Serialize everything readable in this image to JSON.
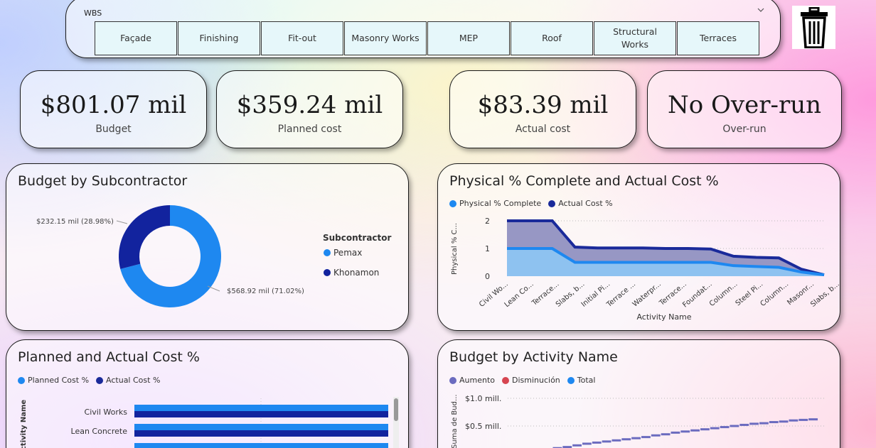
{
  "wbs": {
    "label": "WBS",
    "items": [
      "Façade",
      "Finishing",
      "Fit-out",
      "Masonry Works",
      "MEP",
      "Roof",
      "Structural Works",
      "Terraces"
    ]
  },
  "kpis": [
    {
      "value": "$801.07 mil",
      "label": "Budget"
    },
    {
      "value": "$359.24 mil",
      "label": "Planned cost"
    },
    {
      "value": "$83.39 mil",
      "label": "Actual cost"
    },
    {
      "value": "No Over-run",
      "label": "Over-run"
    }
  ],
  "colors": {
    "light_blue": "#1e88f0",
    "dark_blue": "#1a2a9a",
    "fill_dark": "#9797c4",
    "fill_light": "#8ec2f0",
    "navy": "#12239e",
    "red": "#d64550",
    "purple": "#6b6bbf"
  },
  "chart_data": [
    {
      "type": "pie",
      "title": "Budget by Subcontractor",
      "legend_title": "Subcontractor",
      "categories": [
        "Pemax",
        "Khonamon"
      ],
      "values": [
        568.92,
        232.15
      ],
      "data_labels": [
        "$568.92 mil (71.02%)",
        "$232.15 mil (28.98%)"
      ]
    },
    {
      "type": "area",
      "title": "Physical % Complete and Actual Cost %",
      "xlabel": "Activity Name",
      "ylabel": "Physical % C...",
      "ylim": [
        0,
        2
      ],
      "yticks": [
        "0",
        "1",
        "2"
      ],
      "categories": [
        "Civil Wo...",
        "Lean Co...",
        "Terrace...",
        "Slabs, b...",
        "Initial Pi...",
        "Terrace ...",
        "Waterpr...",
        "Terrace...",
        "Foundat...",
        "Column...",
        "Steel Pi...",
        "Column...",
        "Masonr...",
        "Slabs, b..."
      ],
      "series": [
        {
          "name": "Physical % Complete",
          "values": [
            1.0,
            1.0,
            1.0,
            0.5,
            0.5,
            0.5,
            0.5,
            0.5,
            0.5,
            0.5,
            0.38,
            0.35,
            0.32,
            0.15,
            0.05
          ]
        },
        {
          "name": "Actual Cost %",
          "values": [
            2.0,
            2.0,
            2.0,
            1.05,
            1.02,
            1.02,
            1.02,
            1.0,
            1.0,
            0.98,
            0.72,
            0.68,
            0.66,
            0.25,
            0.05
          ]
        }
      ]
    },
    {
      "type": "bar",
      "title": "Planned and Actual Cost %",
      "ylabel": "ctivity Name",
      "categories": [
        "Civil Works",
        "Lean Concrete"
      ],
      "series": [
        {
          "name": "Planned Cost %",
          "values": [
            1.0,
            1.0,
            1.0
          ]
        },
        {
          "name": "Actual Cost %",
          "values": [
            1.0,
            1.0,
            1.0
          ]
        }
      ]
    },
    {
      "type": "bar",
      "title": "Budget by Activity Name",
      "ylabel": "Suma de Bud...",
      "yticks": [
        "$1.0 mill.",
        "$0.5 mill."
      ],
      "legend": [
        "Aumento",
        "Disminución",
        "Total"
      ],
      "series": [
        {
          "name": "Aumento",
          "values": [
            0.02,
            0.05,
            0.08,
            0.1,
            0.12,
            0.15,
            0.18,
            0.2,
            0.22,
            0.24,
            0.26,
            0.28,
            0.3,
            0.33,
            0.35,
            0.38,
            0.4,
            0.42,
            0.44,
            0.46,
            0.48,
            0.5,
            0.52,
            0.54,
            0.55,
            0.57,
            0.58,
            0.6,
            0.61,
            0.62
          ]
        }
      ]
    }
  ]
}
